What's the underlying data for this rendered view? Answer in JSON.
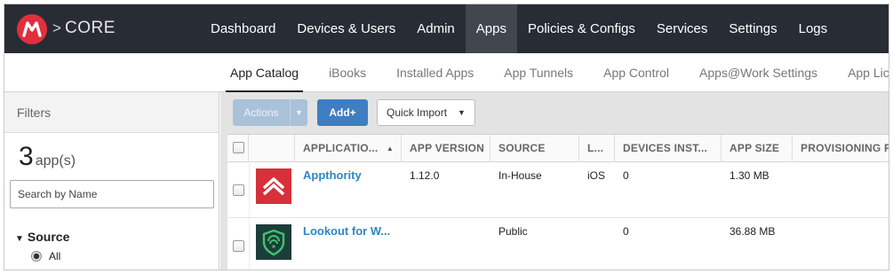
{
  "topbar": {
    "brand": "CORE",
    "brand_separator": ">",
    "logo_icon": "mobileiron-m-logo",
    "nav": [
      {
        "label": "Dashboard",
        "active": false
      },
      {
        "label": "Devices & Users",
        "active": false
      },
      {
        "label": "Admin",
        "active": false
      },
      {
        "label": "Apps",
        "active": true
      },
      {
        "label": "Policies & Configs",
        "active": false
      },
      {
        "label": "Services",
        "active": false
      },
      {
        "label": "Settings",
        "active": false
      },
      {
        "label": "Logs",
        "active": false
      }
    ]
  },
  "subnav": {
    "items": [
      {
        "label": "App Catalog",
        "active": true
      },
      {
        "label": "iBooks",
        "active": false
      },
      {
        "label": "Installed Apps",
        "active": false
      },
      {
        "label": "App Tunnels",
        "active": false
      },
      {
        "label": "App Control",
        "active": false
      },
      {
        "label": "Apps@Work Settings",
        "active": false
      },
      {
        "label": "App Licenses",
        "active": false
      }
    ]
  },
  "filters": {
    "title": "Filters",
    "count": "3",
    "count_unit": "app(s)",
    "search_placeholder": "Search by Name",
    "source_label": "Source",
    "source_option": "All"
  },
  "toolbar": {
    "actions_label": "Actions",
    "add_label": "Add+",
    "quick_import_label": "Quick Import"
  },
  "table": {
    "columns": [
      "APPLICATIO...",
      "APP VERSION",
      "SOURCE",
      "L...",
      "DEVICES INST...",
      "APP SIZE",
      "PROVISIONING PR"
    ],
    "sort_column": "APPLICATIO...",
    "rows": [
      {
        "name": "Appthority",
        "version": "1.12.0",
        "source": "In-House",
        "platform": "iOS",
        "devices": "0",
        "size": "1.30 MB",
        "icon": "appthority-icon"
      },
      {
        "name": "Lookout for W...",
        "version": "",
        "source": "Public",
        "platform": "",
        "devices": "0",
        "size": "36.88 MB",
        "icon": "lookout-shield-icon"
      }
    ]
  },
  "colors": {
    "topbar_bg": "#282c35",
    "active_nav_bg": "#41464f",
    "link_blue": "#2d86c6",
    "add_button": "#3f7ec1",
    "brand_red": "#e0303c"
  }
}
